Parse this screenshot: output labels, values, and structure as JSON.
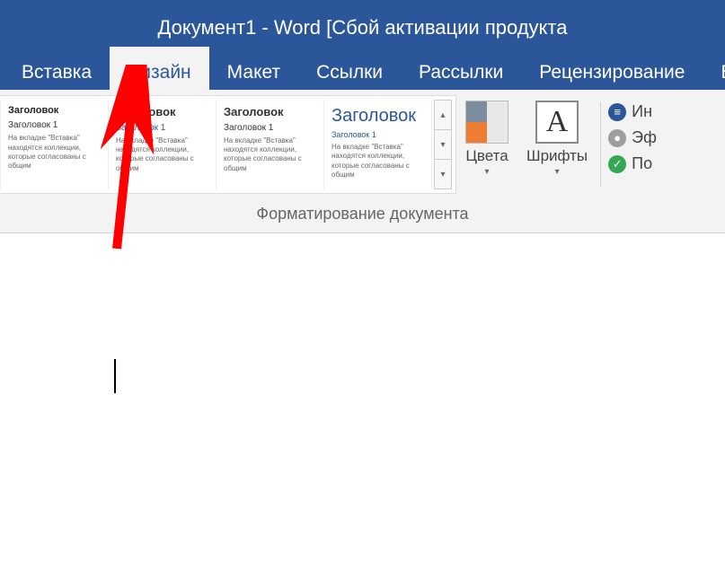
{
  "title": "Документ1 - Word [Сбой активации продукта",
  "tabs": {
    "insert": "Вставка",
    "design": "Дизайн",
    "layout": "Макет",
    "references": "Ссылки",
    "mailings": "Рассылки",
    "review": "Рецензирование",
    "view_partial": "В"
  },
  "gallery": {
    "heading_text": "Заголовок",
    "sub_text": "Заголовок 1",
    "body_text": "На вкладке \"Вставка\" находятся коллекции, которые согласованы с общим"
  },
  "ribbon": {
    "colors_label": "Цвета",
    "fonts_label": "Шрифты",
    "spacing_label": "Ин",
    "effects_label": "Эф",
    "default_label": "По"
  },
  "group_label": "Форматирование документа"
}
